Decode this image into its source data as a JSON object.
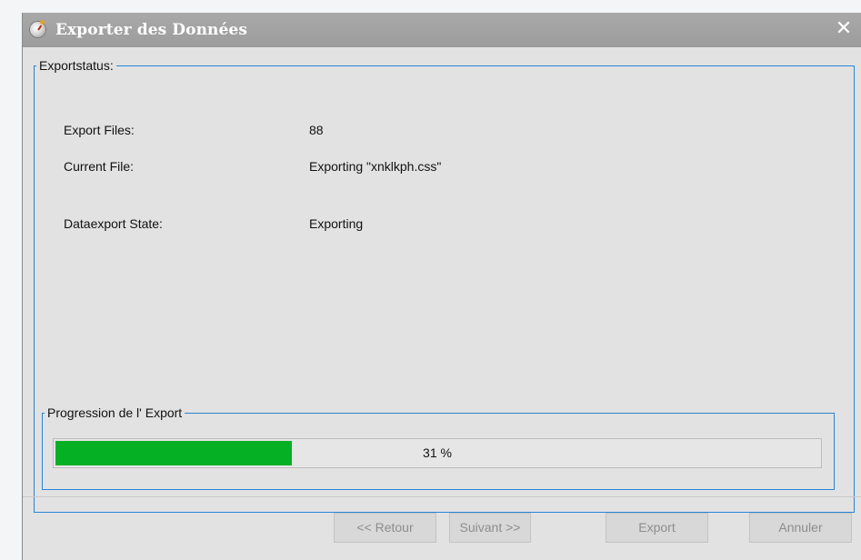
{
  "window": {
    "title": "Exporter des Données",
    "close_glyph": "✕",
    "app_icon": "export-app-icon"
  },
  "status_group": {
    "legend": "Exportstatus:",
    "rows": [
      {
        "label": "Export Files:",
        "value": "88"
      },
      {
        "label": "Current File:",
        "value": "Exporting \"xnklkph.css\""
      },
      {
        "label": "Dataexport State:",
        "value": "Exporting"
      }
    ]
  },
  "progress_group": {
    "legend": "Progression de l' Export",
    "percent": 31,
    "percent_text": "31 %",
    "fill_color": "#06b025"
  },
  "buttons": {
    "back": "<< Retour",
    "next": "Suivant >>",
    "export": "Export",
    "cancel": "Annuler"
  },
  "colors": {
    "titlebar": "#a4a4a4",
    "group_border": "#2a84d4",
    "window_bg": "#e2e2e2"
  }
}
